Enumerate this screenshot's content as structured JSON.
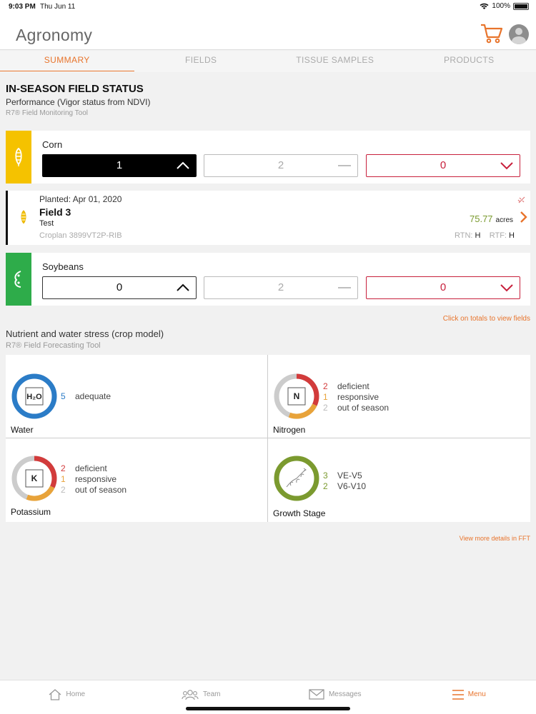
{
  "status_bar": {
    "time": "9:03 PM",
    "date": "Thu Jun 11",
    "battery": "100%"
  },
  "header": {
    "title": "Agronomy"
  },
  "tabs": [
    {
      "label": "SUMMARY",
      "active": true
    },
    {
      "label": "FIELDS",
      "active": false
    },
    {
      "label": "TISSUE SAMPLES",
      "active": false
    },
    {
      "label": "PRODUCTS",
      "active": false
    }
  ],
  "section": {
    "title": "IN-SEASON FIELD STATUS",
    "subtitle": "Performance (Vigor status from NDVI)",
    "tool": "R7® Field Monitoring Tool"
  },
  "crops": [
    {
      "name": "Corn",
      "color": "#f5c200",
      "up": "1",
      "flat": "2",
      "down": "0"
    },
    {
      "name": "Soybeans",
      "color": "#2eac4a",
      "up": "0",
      "flat": "2",
      "down": "0"
    }
  ],
  "field": {
    "planted": "Planted:  Apr 01, 2020",
    "name": "Field 3",
    "farm": "Test",
    "hybrid": "Croplan 3899VT2P-RIB",
    "acres": "75.77",
    "acres_unit": "acres",
    "rtn_label": "RTN:",
    "rtn_value": "H",
    "rtf_label": "RTF:",
    "rtf_value": "H"
  },
  "click_hint": "Click on totals to view fields",
  "nutrients": {
    "title": "Nutrient and water stress (crop model)",
    "tool": "R7® Field Forecasting Tool",
    "water": {
      "label": "Water",
      "count": "5",
      "status": "adequate",
      "symbol": "H2O"
    },
    "nitrogen": {
      "label": "Nitrogen",
      "symbol": "N",
      "deficient": "2",
      "responsive": "1",
      "out_of_season": "2"
    },
    "potassium": {
      "label": "Potassium",
      "symbol": "K",
      "deficient": "2",
      "responsive": "1",
      "out_of_season": "2"
    },
    "growth": {
      "label": "Growth Stage",
      "s1_count": "3",
      "s1_label": "VE-V5",
      "s2_count": "2",
      "s2_label": "V6-V10"
    },
    "status_labels": {
      "deficient": "deficient",
      "responsive": "responsive",
      "out_of_season": "out of season"
    }
  },
  "fft_link": "View more details in FFT",
  "bottom_nav": {
    "home": "Home",
    "team": "Team",
    "messages": "Messages",
    "menu": "Menu"
  },
  "colors": {
    "accent": "#e8742c",
    "red": "#d23b3b",
    "green": "#7b9a2f",
    "blue": "#2b7cc7"
  }
}
